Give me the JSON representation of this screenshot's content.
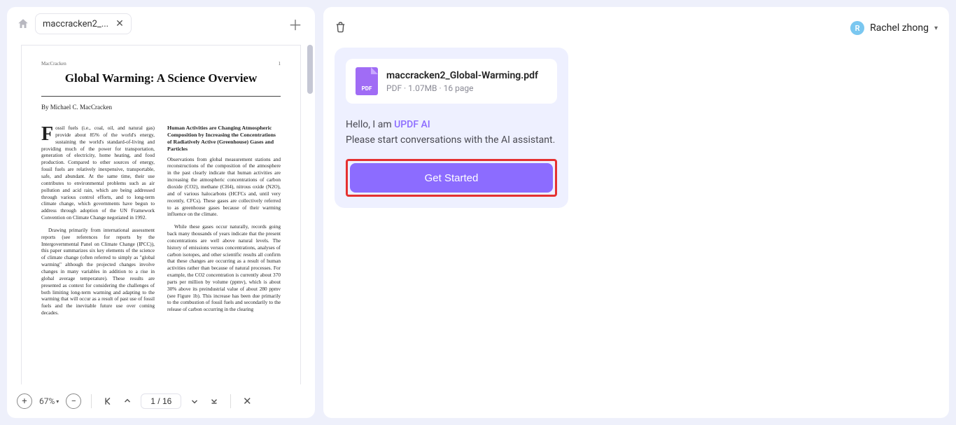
{
  "tab": {
    "label": "maccracken2_..."
  },
  "zoom": {
    "value": "67%"
  },
  "pager": {
    "value": "1 / 16"
  },
  "doc": {
    "running_head": "MacCracken",
    "running_num": "1",
    "title": "Global Warming: A Science Overview",
    "byline": "By Michael C. MacCracken",
    "col1_dropcap": "F",
    "col1_p1": "ossil fuels (i.e., coal, oil, and natural gas) provide about 85% of the world's energy, sustaining the world's standard-of-living and providing much of the power for transportation, generation of electricity, home heating, and food production. Compared to other sources of energy, fossil fuels are relatively inexpensive, transportable, safe, and abundant. At the same time, their use contributes to environmental problems such as air pollution and acid rain, which are being addressed through various control efforts, and to long-term climate change, which governments have begun to address through adoption of the UN Framework Convention on Climate Change negotiated in 1992.",
    "col1_p2": "Drawing primarily from international assessment reports (see references for reports by the Intergovernmental Panel on Climate Change (IPCC)), this paper summarizes six key elements of the science of climate change (often referred to simply as \"global warming\" although the projected changes involve changes in many variables in addition to a rise in global average temperature). These results are presented as context for considering the challenges of both limiting long-term warming and adapting to the warming that will occur as a result of past use of fossil fuels and the inevitable future use over coming decades.",
    "col2_h": "Human Activities are Changing Atmospheric Composition by Increasing the Concentrations of Radiatively Active (Greenhouse) Gases and Particles",
    "col2_p1": "Observations from global measurement stations and reconstructions of the composition of the atmosphere in the past clearly indicate that human activities are increasing the atmospheric concentrations of carbon dioxide (CO2), methane (CH4), nitrous oxide (N2O), and of various halocarbons (HCFCs and, until very recently, CFCs). These gases are collectively referred to as greenhouse gases because of their warming influence on the climate.",
    "col2_p2": "While these gases occur naturally, records going back many thousands of years indicate that the present concentrations are well above natural levels. The history of emissions versus concentrations, analyses of carbon isotopes, and other scientific results all confirm that these changes are occurring as a result of human activities rather than because of natural processes. For example, the CO2 concentration is currently about 370 parts per million by volume (ppmv), which is about 30% above its preindustrial value of about 280 ppmv (see Figure 1b). This increase has been due primarily to the combustion of fossil fuels and secondarily to the release of carbon occurring in the clearing"
  },
  "user": {
    "initial": "R",
    "name": "Rachel zhong"
  },
  "file": {
    "badge": "PDF",
    "name": "maccracken2_Global-Warming.pdf",
    "type": "PDF",
    "size": "1.07MB",
    "pages": "16 page"
  },
  "ai": {
    "hello": "Hello, I am ",
    "brand": "UPDF AI",
    "prompt": "Please start conversations with the AI assistant.",
    "cta": "Get Started"
  }
}
